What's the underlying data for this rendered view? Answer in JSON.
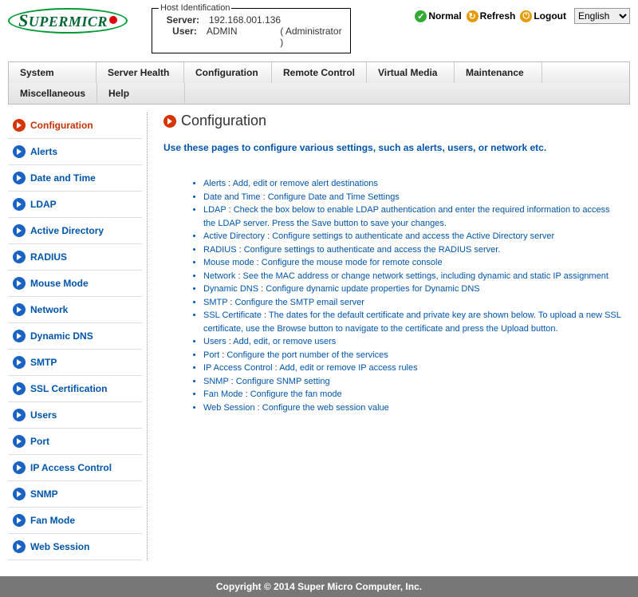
{
  "hostid": {
    "legend": "Host Identification",
    "server_label": "Server:",
    "server_value": "192.168.001.136",
    "user_label": "User:",
    "user_value": "ADMIN",
    "user_role": "( Administrator )"
  },
  "header_links": {
    "normal": "Normal",
    "refresh": "Refresh",
    "logout": "Logout"
  },
  "language": {
    "selected": "English"
  },
  "menu": {
    "row1": [
      "System",
      "Server Health",
      "Configuration",
      "Remote Control",
      "Virtual Media",
      "Maintenance"
    ],
    "row2": [
      "Miscellaneous",
      "Help"
    ]
  },
  "sidebar": {
    "items": [
      {
        "label": "Configuration",
        "active": true
      },
      {
        "label": "Alerts"
      },
      {
        "label": "Date and Time"
      },
      {
        "label": "LDAP"
      },
      {
        "label": "Active Directory"
      },
      {
        "label": "RADIUS"
      },
      {
        "label": "Mouse Mode"
      },
      {
        "label": "Network"
      },
      {
        "label": "Dynamic DNS"
      },
      {
        "label": "SMTP"
      },
      {
        "label": "SSL Certification"
      },
      {
        "label": "Users"
      },
      {
        "label": "Port"
      },
      {
        "label": "IP Access Control"
      },
      {
        "label": "SNMP"
      },
      {
        "label": "Fan Mode"
      },
      {
        "label": "Web Session"
      }
    ]
  },
  "page": {
    "title": "Configuration",
    "intro": "Use these pages to configure various settings, such as alerts, users, or network etc.",
    "items": [
      {
        "k": "Alerts",
        "d": "Add, edit or remove alert destinations"
      },
      {
        "k": "Date and Time",
        "d": "Configure Date and Time Settings"
      },
      {
        "k": "LDAP",
        "d": "Check the box below to enable LDAP authentication and enter the required information to access the LDAP server. Press the Save button to save your changes."
      },
      {
        "k": "Active Directory",
        "d": "Configure settings to authenticate and access the Active Directory server"
      },
      {
        "k": "RADIUS",
        "d": "Configure settings to authenticate and access the RADIUS server."
      },
      {
        "k": "Mouse mode",
        "d": "Configure the mouse mode for remote console"
      },
      {
        "k": "Network",
        "d": "See the MAC address or change network settings, including dynamic and static IP assignment"
      },
      {
        "k": "Dynamic DNS",
        "d": "Configure dynamic update properties for Dynamic DNS"
      },
      {
        "k": "SMTP",
        "d": "Configure the SMTP email server"
      },
      {
        "k": "SSL Certificate",
        "d": "The dates for the default certificate and private key are shown below. To upload a new SSL certificate, use the Browse button to navigate to the certificate and press the Upload button."
      },
      {
        "k": "Users",
        "d": "Add, edit, or remove users"
      },
      {
        "k": "Port",
        "d": "Configure the port number of the services"
      },
      {
        "k": "IP Access Control",
        "d": "Add, edit or remove IP access rules"
      },
      {
        "k": "SNMP",
        "d": "Configure SNMP setting"
      },
      {
        "k": "Fan Mode",
        "d": "Configure the fan mode"
      },
      {
        "k": "Web Session",
        "d": "Configure the web session value"
      }
    ]
  },
  "footer": "Copyright © 2014 Super Micro Computer, Inc."
}
